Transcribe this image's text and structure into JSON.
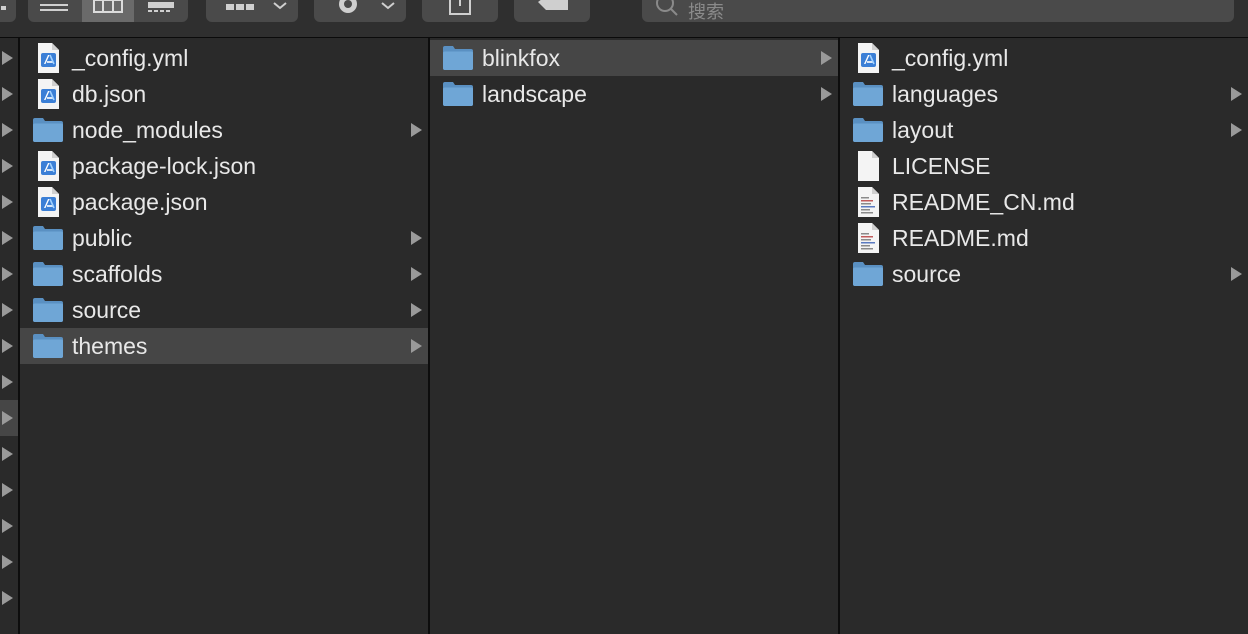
{
  "toolbar": {
    "search_placeholder": "搜索",
    "view_icons": [
      "list-view-icon",
      "column-view-icon",
      "gallery-view-icon"
    ],
    "group_icon": "group-icon",
    "action_icon": "gear-icon",
    "share_icon": "share-icon",
    "tag_icon": "tag-icon"
  },
  "column1": {
    "items": [
      {
        "name": "_config.yml",
        "icon": "xcode-document-icon",
        "folder": false
      },
      {
        "name": "db.json",
        "icon": "xcode-document-icon",
        "folder": false
      },
      {
        "name": "node_modules",
        "icon": "folder-icon",
        "folder": true
      },
      {
        "name": "package-lock.json",
        "icon": "xcode-document-icon",
        "folder": false
      },
      {
        "name": "package.json",
        "icon": "xcode-document-icon",
        "folder": false
      },
      {
        "name": "public",
        "icon": "folder-icon",
        "folder": true
      },
      {
        "name": "scaffolds",
        "icon": "folder-icon",
        "folder": true
      },
      {
        "name": "source",
        "icon": "folder-icon",
        "folder": true
      },
      {
        "name": "themes",
        "icon": "folder-icon",
        "folder": true,
        "selected": true
      }
    ]
  },
  "column2": {
    "items": [
      {
        "name": "blinkfox",
        "icon": "folder-icon",
        "folder": true,
        "selected": true
      },
      {
        "name": "landscape",
        "icon": "folder-icon",
        "folder": true
      }
    ]
  },
  "column3": {
    "items": [
      {
        "name": "_config.yml",
        "icon": "xcode-document-icon",
        "folder": false
      },
      {
        "name": "languages",
        "icon": "folder-icon",
        "folder": true
      },
      {
        "name": "layout",
        "icon": "folder-icon",
        "folder": true
      },
      {
        "name": "LICENSE",
        "icon": "blank-document-icon",
        "folder": false
      },
      {
        "name": "README_CN.md",
        "icon": "text-document-icon",
        "folder": false
      },
      {
        "name": "README.md",
        "icon": "text-document-icon",
        "folder": false
      },
      {
        "name": "source",
        "icon": "folder-icon",
        "folder": true
      }
    ]
  },
  "colors": {
    "folder_front": "#6fa6d6",
    "folder_back": "#5a90c2",
    "selection": "#464646",
    "window_bg": "#2a2a2a"
  }
}
